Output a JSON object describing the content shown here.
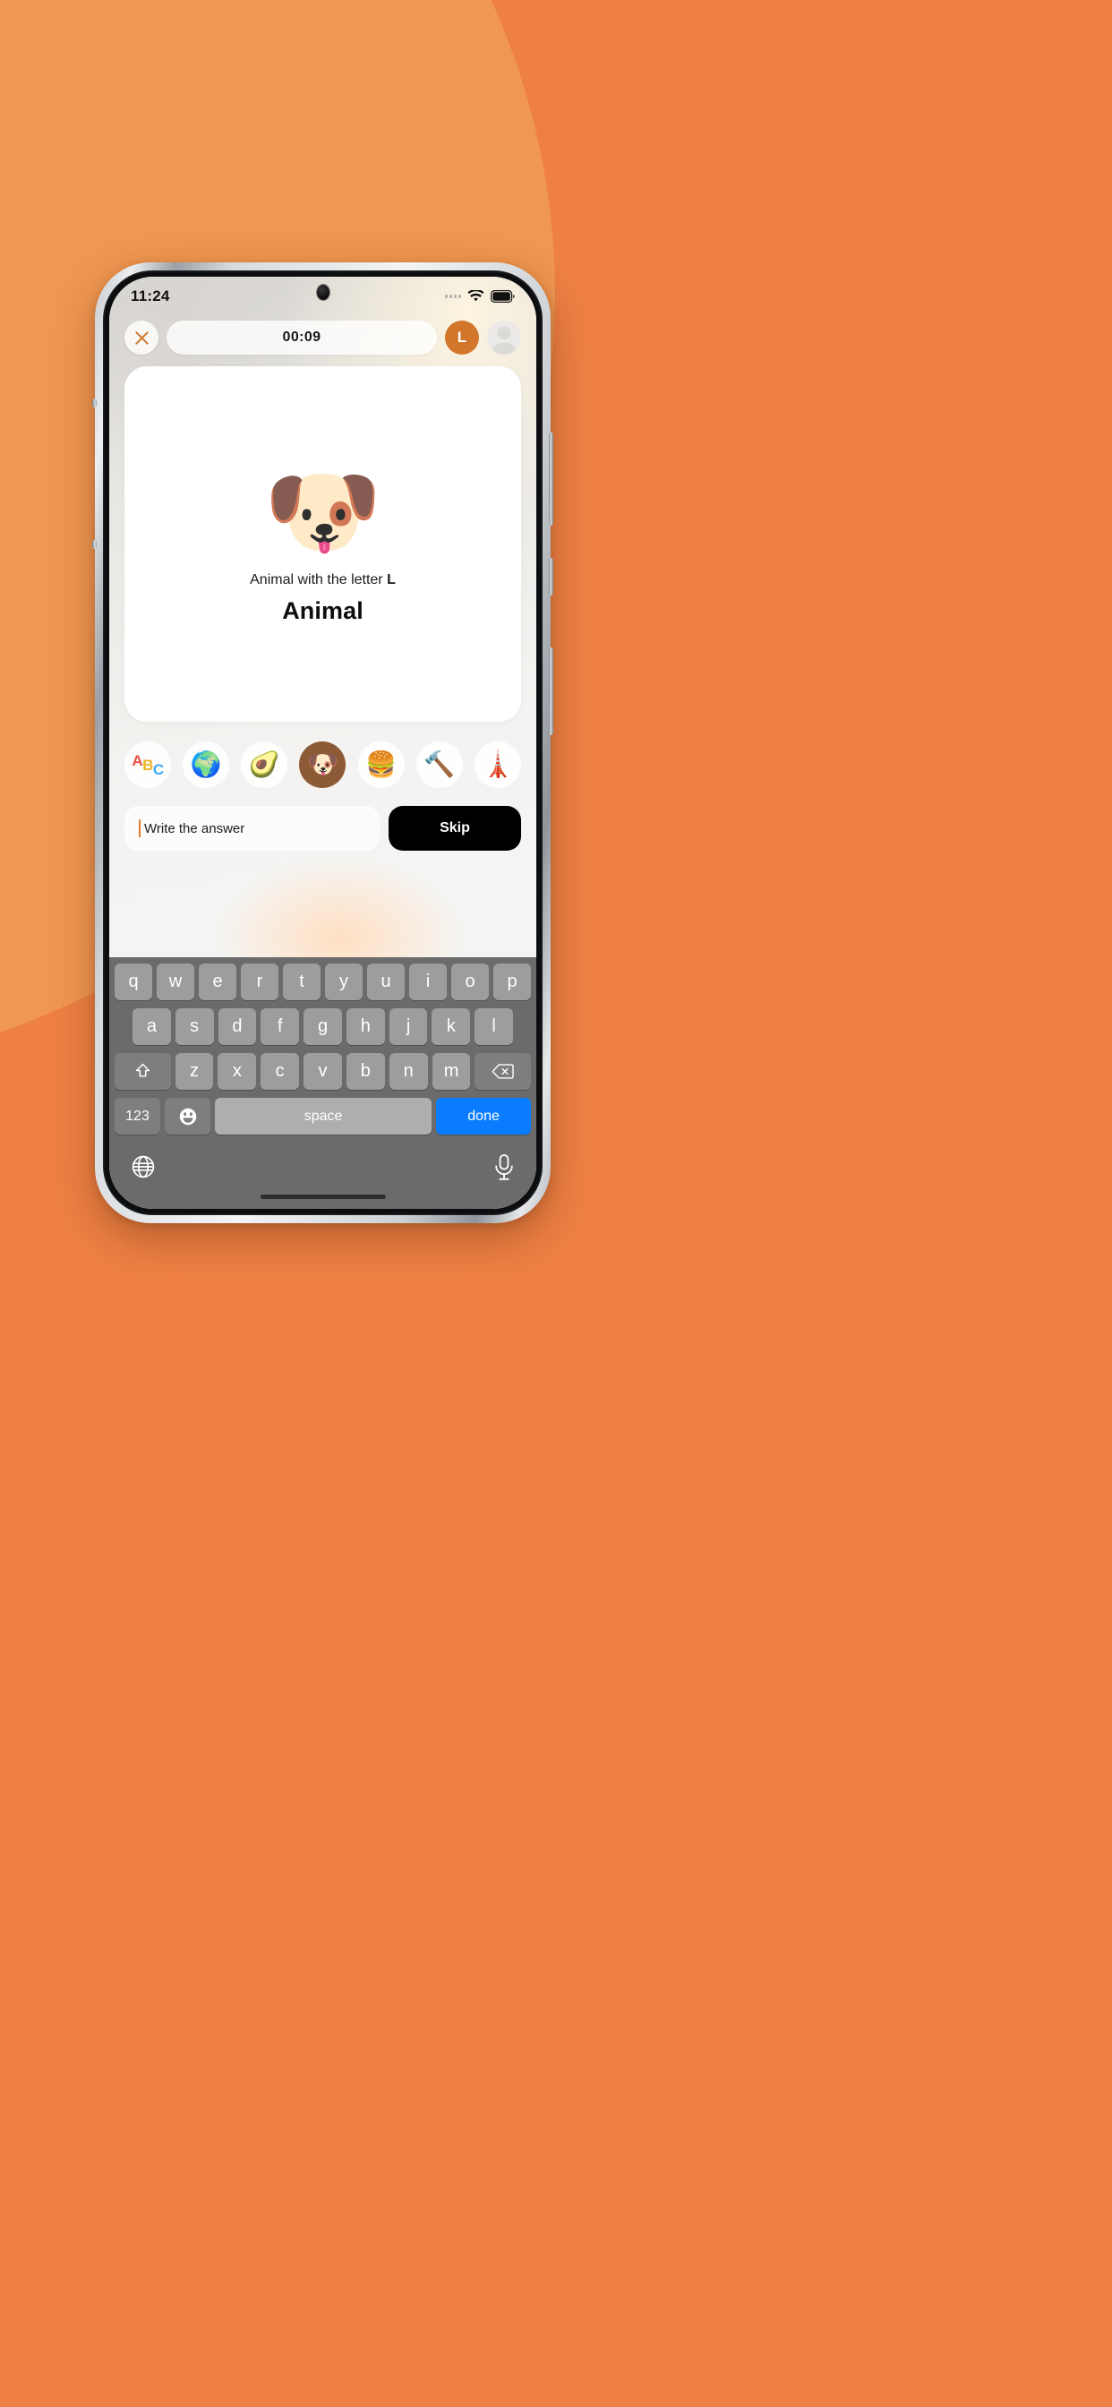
{
  "background": {
    "base_color": "#EE8043",
    "arc_color": "#F09751"
  },
  "status_bar": {
    "time": "11:24",
    "signal_icon": "signal-dots-icon",
    "wifi_icon": "wifi-icon",
    "battery_icon": "battery-full-icon"
  },
  "top_nav": {
    "close_icon": "close-x-icon",
    "timer": "00:09",
    "player_avatar_initial": "L",
    "player_avatar_color": "#D2762B",
    "second_avatar_icon": "person-placeholder-icon"
  },
  "card": {
    "emoji": "🐶",
    "emoji_name": "dog-face-emoji",
    "prompt_prefix": "Animal with the letter ",
    "prompt_letter": "L",
    "category_title": "Animal"
  },
  "categories": [
    {
      "id": "letters",
      "icon_name": "abc-letters-icon",
      "glyph": "ABC",
      "active": false
    },
    {
      "id": "geography",
      "icon_name": "earth-globe-icon",
      "glyph": "🌍",
      "active": false
    },
    {
      "id": "food-plant",
      "icon_name": "avocado-icon",
      "glyph": "🥑",
      "active": false
    },
    {
      "id": "animal",
      "icon_name": "dog-face-icon",
      "glyph": "🐶",
      "active": true
    },
    {
      "id": "food",
      "icon_name": "hamburger-icon",
      "glyph": "🍔",
      "active": false
    },
    {
      "id": "tools",
      "icon_name": "hammer-icon",
      "glyph": "🔨",
      "active": false
    },
    {
      "id": "places",
      "icon_name": "tokyo-tower-icon",
      "glyph": "🗼",
      "active": false
    }
  ],
  "answer_row": {
    "input_placeholder": "Write the answer",
    "input_value": "",
    "skip_label": "Skip"
  },
  "keyboard": {
    "row1": [
      "q",
      "w",
      "e",
      "r",
      "t",
      "y",
      "u",
      "i",
      "o",
      "p"
    ],
    "row2": [
      "a",
      "s",
      "d",
      "f",
      "g",
      "h",
      "j",
      "k",
      "l"
    ],
    "row3": [
      "z",
      "x",
      "c",
      "v",
      "b",
      "n",
      "m"
    ],
    "shift_icon": "shift-arrow-icon",
    "backspace_icon": "backspace-icon",
    "numbers_label": "123",
    "emoji_icon": "emoji-smiley-icon",
    "space_label": "space",
    "done_label": "done",
    "done_color": "#0A7CFF",
    "globe_icon": "globe-language-icon",
    "mic_icon": "microphone-icon"
  }
}
